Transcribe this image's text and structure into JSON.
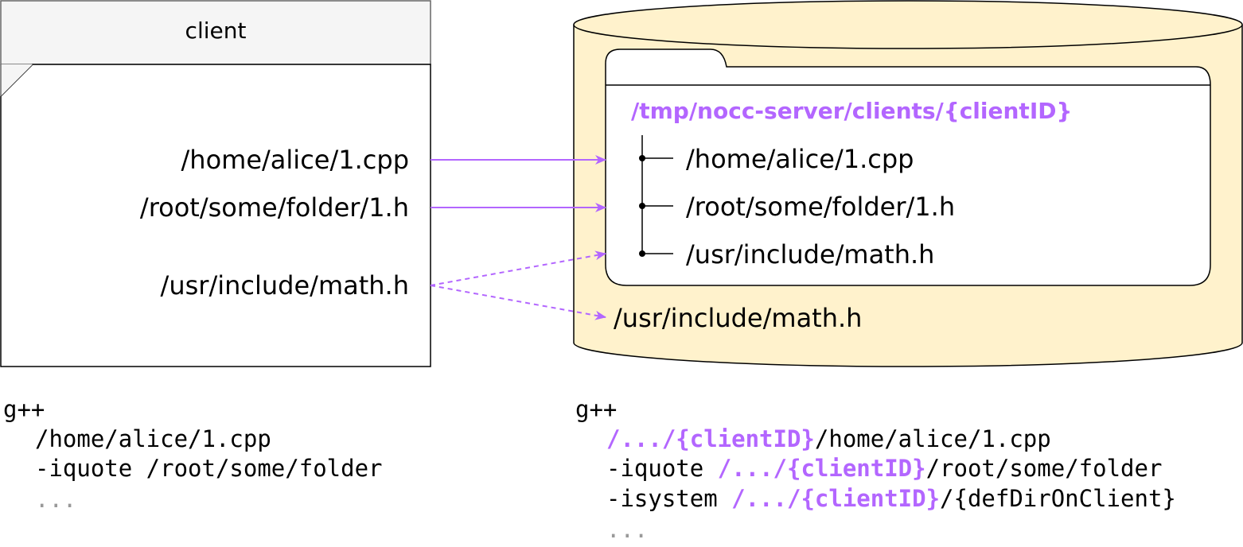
{
  "client": {
    "title": "client",
    "files": [
      "/home/alice/1.cpp",
      "/root/some/folder/1.h",
      "/usr/include/math.h"
    ]
  },
  "server": {
    "folder_path": "/tmp/nocc-server/clients/{clientID}",
    "files": [
      "/home/alice/1.cpp",
      "/root/some/folder/1.h",
      "/usr/include/math.h"
    ],
    "system_file": "/usr/include/math.h"
  },
  "client_cmd": {
    "line1": "g++",
    "line2": "/home/alice/1.cpp",
    "line3": "-iquote /root/some/folder",
    "line4": "..."
  },
  "server_cmd": {
    "line1": "g++",
    "prefix": "/.../{clientID}",
    "line2_rest": "/home/alice/1.cpp",
    "line3_flag": "-iquote ",
    "line3_rest": "/root/some/folder",
    "line4_flag": "-isystem ",
    "line4_rest": "/{defDirOnClient}",
    "line5": "..."
  },
  "colors": {
    "accent": "#b366ff",
    "cylinder_fill": "#fff2cc",
    "header_fill": "#f5f5f5",
    "ellipsis_gray": "#999999"
  }
}
